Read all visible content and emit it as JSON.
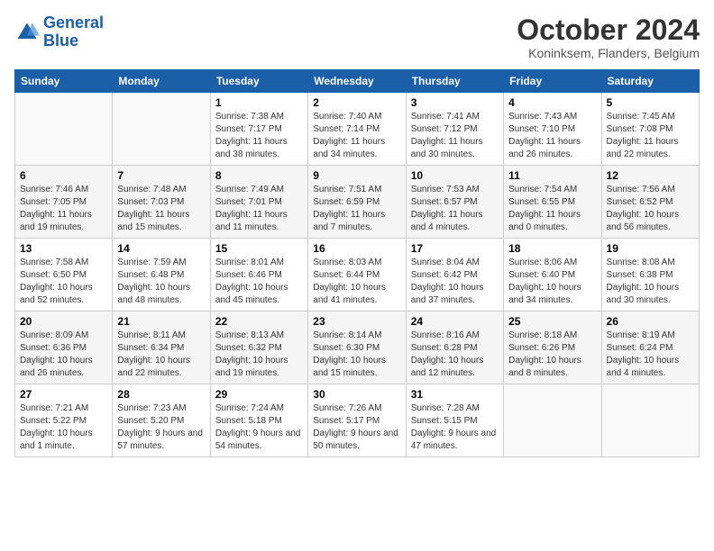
{
  "header": {
    "logo_general": "General",
    "logo_blue": "Blue",
    "month_title": "October 2024",
    "location": "Koninksem, Flanders, Belgium"
  },
  "weekdays": [
    "Sunday",
    "Monday",
    "Tuesday",
    "Wednesday",
    "Thursday",
    "Friday",
    "Saturday"
  ],
  "weeks": [
    [
      {
        "day": "",
        "info": ""
      },
      {
        "day": "",
        "info": ""
      },
      {
        "day": "1",
        "info": "Sunrise: 7:38 AM\nSunset: 7:17 PM\nDaylight: 11 hours and 38 minutes."
      },
      {
        "day": "2",
        "info": "Sunrise: 7:40 AM\nSunset: 7:14 PM\nDaylight: 11 hours and 34 minutes."
      },
      {
        "day": "3",
        "info": "Sunrise: 7:41 AM\nSunset: 7:12 PM\nDaylight: 11 hours and 30 minutes."
      },
      {
        "day": "4",
        "info": "Sunrise: 7:43 AM\nSunset: 7:10 PM\nDaylight: 11 hours and 26 minutes."
      },
      {
        "day": "5",
        "info": "Sunrise: 7:45 AM\nSunset: 7:08 PM\nDaylight: 11 hours and 22 minutes."
      }
    ],
    [
      {
        "day": "6",
        "info": "Sunrise: 7:46 AM\nSunset: 7:05 PM\nDaylight: 11 hours and 19 minutes."
      },
      {
        "day": "7",
        "info": "Sunrise: 7:48 AM\nSunset: 7:03 PM\nDaylight: 11 hours and 15 minutes."
      },
      {
        "day": "8",
        "info": "Sunrise: 7:49 AM\nSunset: 7:01 PM\nDaylight: 11 hours and 11 minutes."
      },
      {
        "day": "9",
        "info": "Sunrise: 7:51 AM\nSunset: 6:59 PM\nDaylight: 11 hours and 7 minutes."
      },
      {
        "day": "10",
        "info": "Sunrise: 7:53 AM\nSunset: 6:57 PM\nDaylight: 11 hours and 4 minutes."
      },
      {
        "day": "11",
        "info": "Sunrise: 7:54 AM\nSunset: 6:55 PM\nDaylight: 11 hours and 0 minutes."
      },
      {
        "day": "12",
        "info": "Sunrise: 7:56 AM\nSunset: 6:52 PM\nDaylight: 10 hours and 56 minutes."
      }
    ],
    [
      {
        "day": "13",
        "info": "Sunrise: 7:58 AM\nSunset: 6:50 PM\nDaylight: 10 hours and 52 minutes."
      },
      {
        "day": "14",
        "info": "Sunrise: 7:59 AM\nSunset: 6:48 PM\nDaylight: 10 hours and 48 minutes."
      },
      {
        "day": "15",
        "info": "Sunrise: 8:01 AM\nSunset: 6:46 PM\nDaylight: 10 hours and 45 minutes."
      },
      {
        "day": "16",
        "info": "Sunrise: 8:03 AM\nSunset: 6:44 PM\nDaylight: 10 hours and 41 minutes."
      },
      {
        "day": "17",
        "info": "Sunrise: 8:04 AM\nSunset: 6:42 PM\nDaylight: 10 hours and 37 minutes."
      },
      {
        "day": "18",
        "info": "Sunrise: 8:06 AM\nSunset: 6:40 PM\nDaylight: 10 hours and 34 minutes."
      },
      {
        "day": "19",
        "info": "Sunrise: 8:08 AM\nSunset: 6:38 PM\nDaylight: 10 hours and 30 minutes."
      }
    ],
    [
      {
        "day": "20",
        "info": "Sunrise: 8:09 AM\nSunset: 6:36 PM\nDaylight: 10 hours and 26 minutes."
      },
      {
        "day": "21",
        "info": "Sunrise: 8:11 AM\nSunset: 6:34 PM\nDaylight: 10 hours and 22 minutes."
      },
      {
        "day": "22",
        "info": "Sunrise: 8:13 AM\nSunset: 6:32 PM\nDaylight: 10 hours and 19 minutes."
      },
      {
        "day": "23",
        "info": "Sunrise: 8:14 AM\nSunset: 6:30 PM\nDaylight: 10 hours and 15 minutes."
      },
      {
        "day": "24",
        "info": "Sunrise: 8:16 AM\nSunset: 6:28 PM\nDaylight: 10 hours and 12 minutes."
      },
      {
        "day": "25",
        "info": "Sunrise: 8:18 AM\nSunset: 6:26 PM\nDaylight: 10 hours and 8 minutes."
      },
      {
        "day": "26",
        "info": "Sunrise: 8:19 AM\nSunset: 6:24 PM\nDaylight: 10 hours and 4 minutes."
      }
    ],
    [
      {
        "day": "27",
        "info": "Sunrise: 7:21 AM\nSunset: 5:22 PM\nDaylight: 10 hours and 1 minute."
      },
      {
        "day": "28",
        "info": "Sunrise: 7:23 AM\nSunset: 5:20 PM\nDaylight: 9 hours and 57 minutes."
      },
      {
        "day": "29",
        "info": "Sunrise: 7:24 AM\nSunset: 5:18 PM\nDaylight: 9 hours and 54 minutes."
      },
      {
        "day": "30",
        "info": "Sunrise: 7:26 AM\nSunset: 5:17 PM\nDaylight: 9 hours and 50 minutes."
      },
      {
        "day": "31",
        "info": "Sunrise: 7:28 AM\nSunset: 5:15 PM\nDaylight: 9 hours and 47 minutes."
      },
      {
        "day": "",
        "info": ""
      },
      {
        "day": "",
        "info": ""
      }
    ]
  ]
}
